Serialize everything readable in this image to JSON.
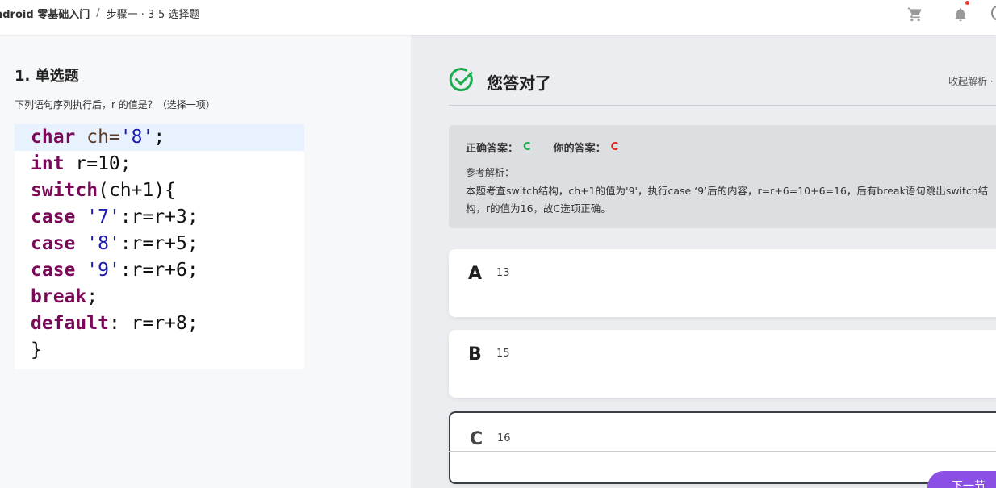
{
  "topbar": {
    "course": "ndroid 零基础入门",
    "separator": "/",
    "step": "步骤一 · 3-5 选择题",
    "icons": [
      "cart-icon",
      "bell-icon",
      "user-icon"
    ],
    "notification_dot_color": "#e53935"
  },
  "question": {
    "title": "1. 单选题",
    "description": "下列语句序列执行后，r 的值是？（选择一项）",
    "code_lines": [
      [
        {
          "t": "char",
          "c": "kw"
        },
        {
          "t": " ch=",
          "c": "id"
        },
        {
          "t": "'8'",
          "c": "str"
        },
        {
          "t": ";",
          "c": "pl"
        }
      ],
      [
        {
          "t": "int",
          "c": "kw"
        },
        {
          "t": " r=10;",
          "c": "pl"
        }
      ],
      [
        {
          "t": "switch",
          "c": "kw"
        },
        {
          "t": "(ch+1){",
          "c": "pl"
        }
      ],
      [
        {
          "t": "case",
          "c": "kw"
        },
        {
          "t": " ",
          "c": "pl"
        },
        {
          "t": "'7'",
          "c": "str"
        },
        {
          "t": ":r=r+3;",
          "c": "pl"
        }
      ],
      [
        {
          "t": "case",
          "c": "kw"
        },
        {
          "t": " ",
          "c": "pl"
        },
        {
          "t": "'8'",
          "c": "str"
        },
        {
          "t": ":r=r+5;",
          "c": "pl"
        }
      ],
      [
        {
          "t": "case",
          "c": "kw"
        },
        {
          "t": " ",
          "c": "pl"
        },
        {
          "t": "'9'",
          "c": "str"
        },
        {
          "t": ":r=r+6;",
          "c": "pl"
        }
      ],
      [
        {
          "t": "break",
          "c": "kw"
        },
        {
          "t": ";",
          "c": "pl"
        }
      ],
      [
        {
          "t": "default",
          "c": "kw"
        },
        {
          "t": ": r=r+8;",
          "c": "pl"
        }
      ],
      [
        {
          "t": "}",
          "c": "pl"
        }
      ]
    ]
  },
  "result": {
    "status": "您答对了",
    "status_color": "#1aad4f",
    "toggle_label": "收起解析 ·",
    "correct_label": "正确答案：",
    "correct_value": "C",
    "your_label": "你的答案：",
    "your_value": "C",
    "reference_label": "参考解析：",
    "reference_text": "本题考查switch结构，ch+1的值为'9'，执行case ‘9’后的内容，r=r+6=10+6=16，后有break语句跳出switch结构，r的值为16，故C选项正确。"
  },
  "options": [
    {
      "letter": "A",
      "value": "13"
    },
    {
      "letter": "B",
      "value": "15"
    },
    {
      "letter": "C",
      "value": "16"
    }
  ],
  "next_button": "下一节",
  "accent_color": "#8b4fe6"
}
